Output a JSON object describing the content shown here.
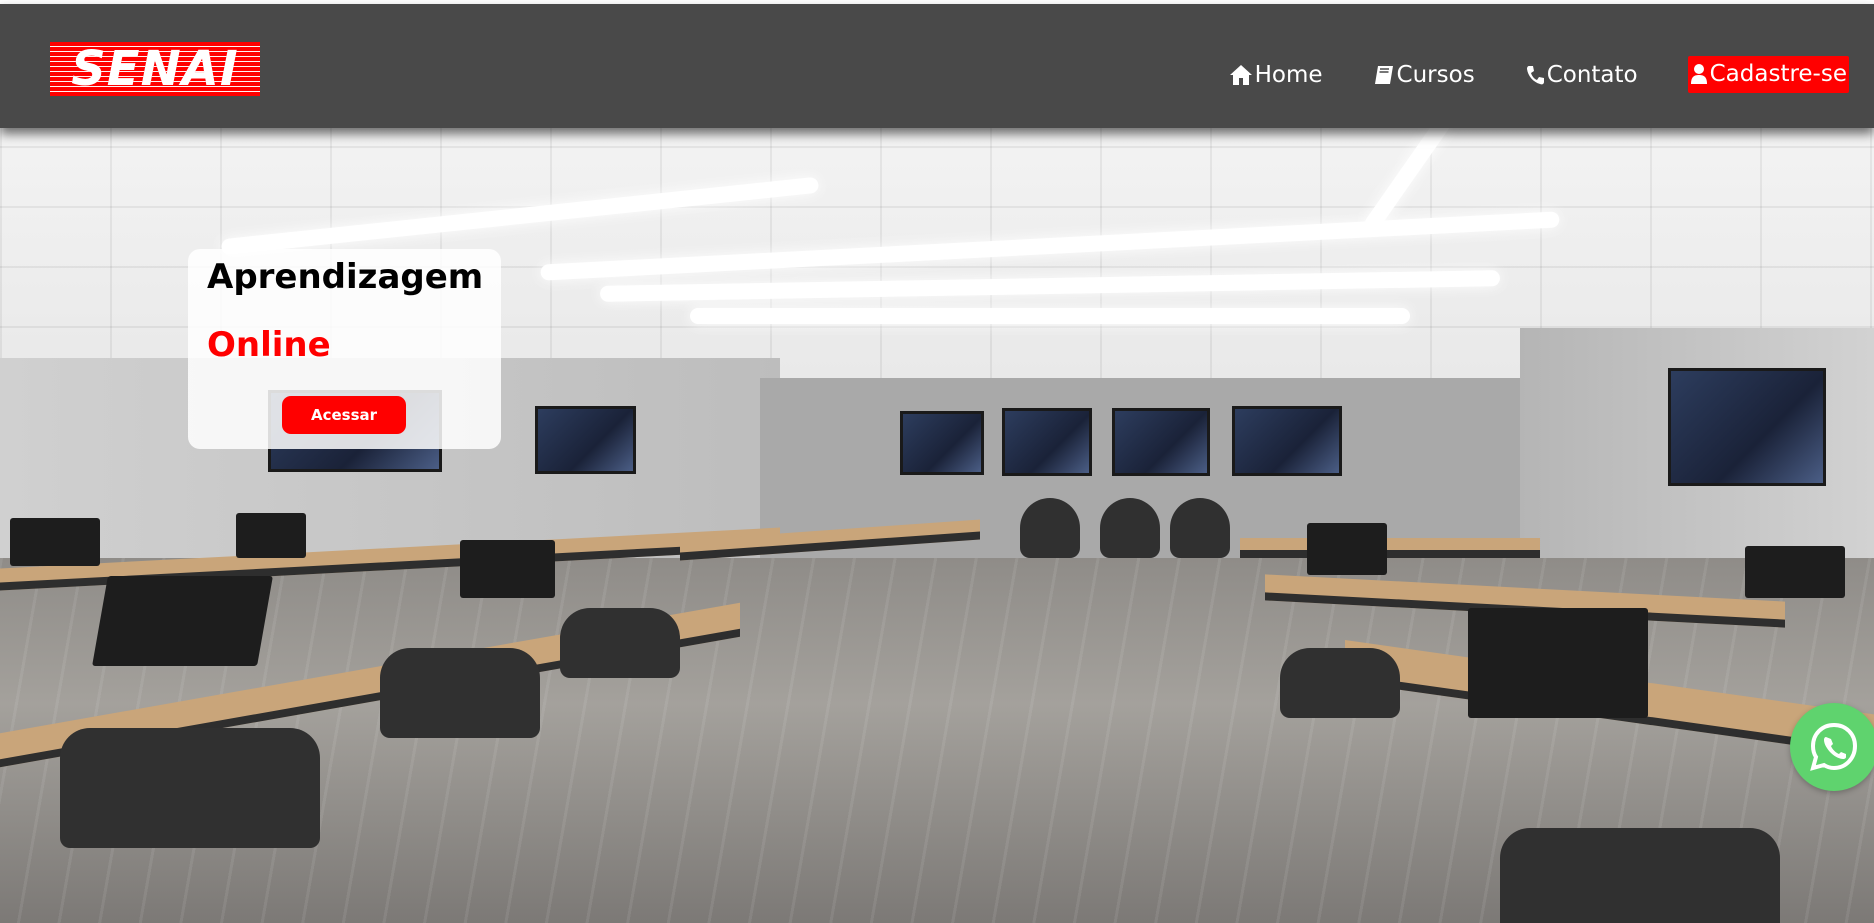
{
  "brand": {
    "logo_text": "SENAI",
    "primary_color": "#ff0000",
    "header_color": "#494949"
  },
  "nav": {
    "items": [
      {
        "label": "Home",
        "icon": "home-icon"
      },
      {
        "label": "Cursos",
        "icon": "book-icon"
      },
      {
        "label": "Contato",
        "icon": "phone-icon"
      },
      {
        "label": "Cadastre-se",
        "icon": "user-icon"
      }
    ]
  },
  "hero": {
    "title": "Aprendizagem",
    "subtitle": "Online",
    "button_label": "Acessar",
    "background": "computer classroom photo"
  },
  "floating": {
    "whatsapp_icon": "whatsapp-icon",
    "whatsapp_color": "#5fd36e"
  }
}
